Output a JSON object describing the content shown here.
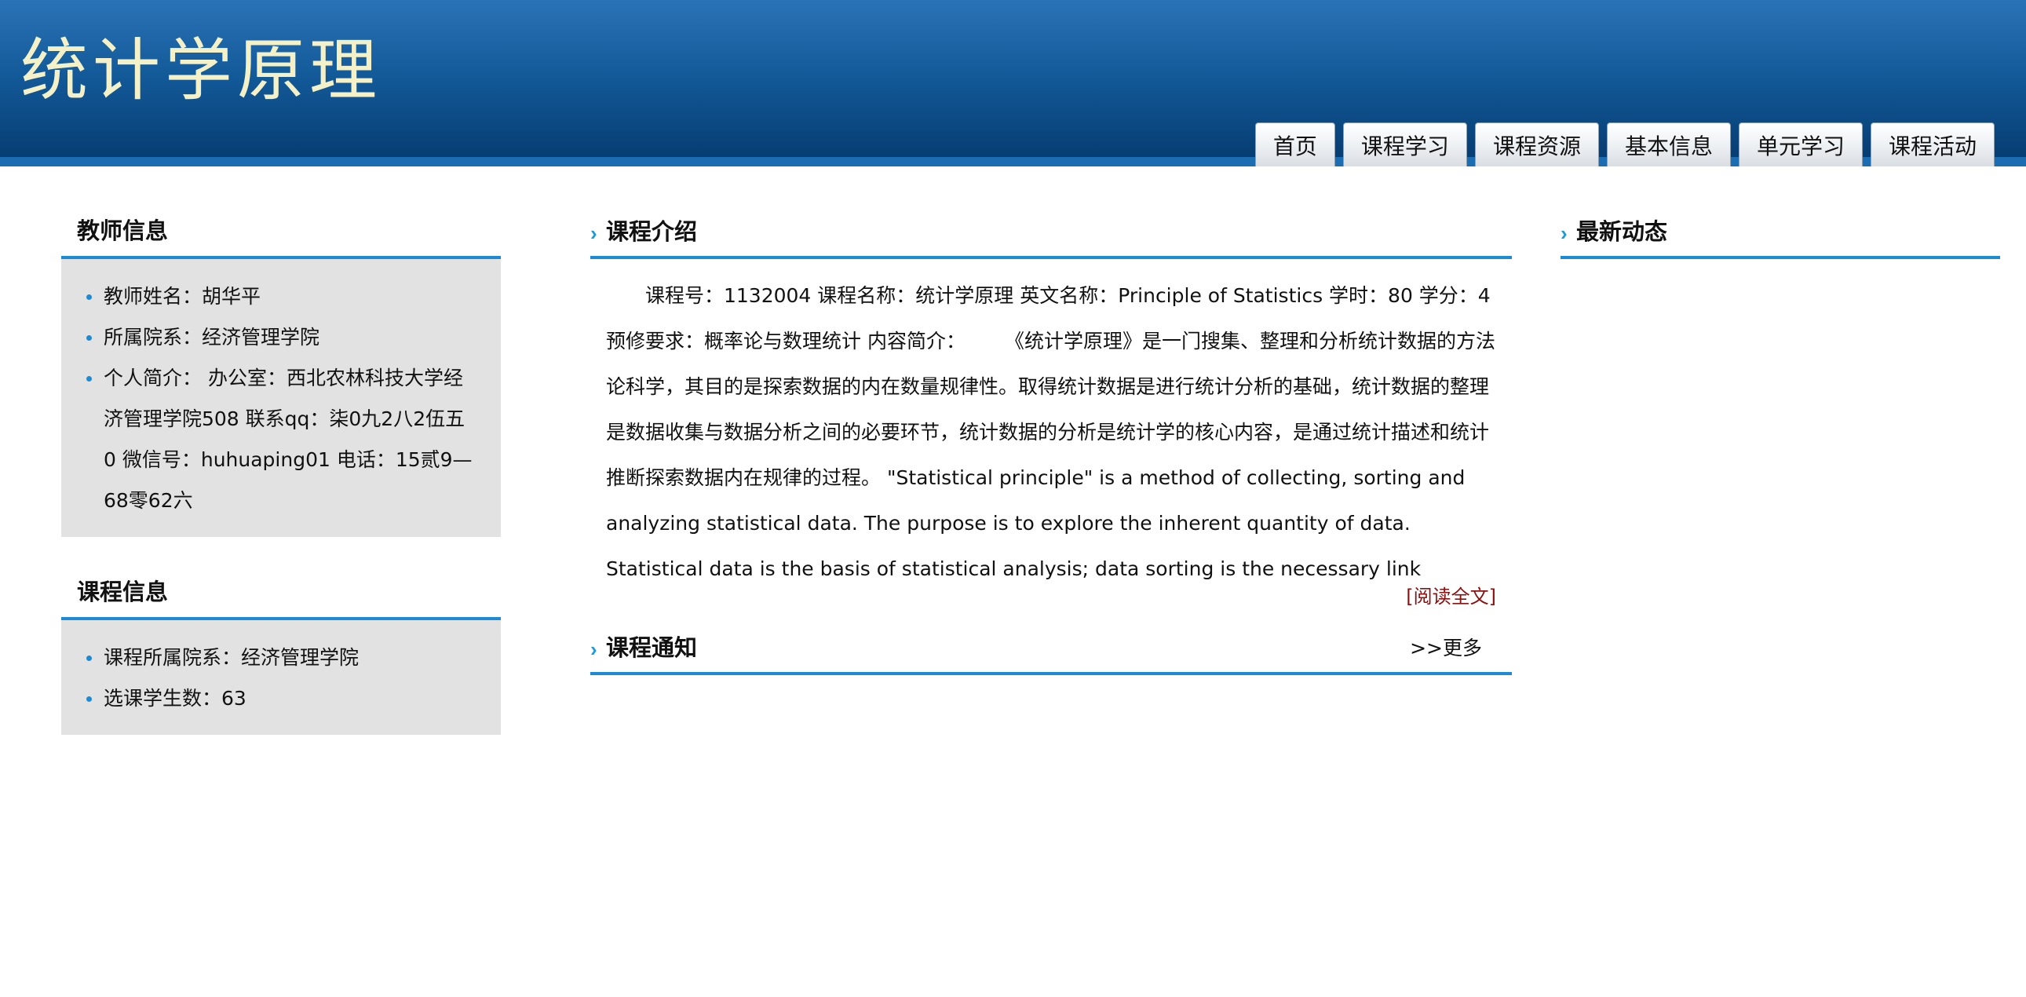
{
  "header": {
    "site_title": "统计学原理",
    "nav": [
      "首页",
      "课程学习",
      "课程资源",
      "基本信息",
      "单元学习",
      "课程活动"
    ]
  },
  "teacher_info": {
    "title": "教师信息",
    "items": [
      "教师姓名：胡华平",
      "所属院系：经济管理学院",
      "个人简介： 办公室：西北农林科技大学经济管理学院508 联系qq：柒0九2八2伍五0 微信号：huhuaping01 电话：15贰9—68零62六"
    ]
  },
  "course_info": {
    "title": "课程信息",
    "items": [
      "课程所属院系：经济管理学院",
      "选课学生数：63"
    ]
  },
  "intro": {
    "title": "课程介绍",
    "text": "课程号：1132004 课程名称：统计学原理 英文名称：Principle of Statistics 学时：80 学分：4 预修要求：概率论与数理统计 内容简介：　　　《统计学原理》是一门搜集、整理和分析统计数据的方法论科学，其目的是探索数据的内在数量规律性。取得统计数据是进行统计分析的基础，统计数据的整理是数据收集与数据分析之间的必要环节，统计数据的分析是统计学的核心内容，是通过统计描述和统计推断探索数据内在规律的过程。 \"Statistical principle\" is a method of collecting, sorting and analyzing statistical data. The purpose is to explore the inherent quantity of data. Statistical data is the basis of statistical analysis; data sorting is the necessary link between data collection and data analysis,",
    "read_more": "[阅读全文]"
  },
  "notice": {
    "title": "课程通知",
    "more": ">>更多"
  },
  "news": {
    "title": "最新动态"
  },
  "colors": {
    "header_top": "#2a73b6",
    "header_bottom": "#053a6e",
    "accent": "#1d8ad6",
    "read_more": "#8b1010"
  }
}
